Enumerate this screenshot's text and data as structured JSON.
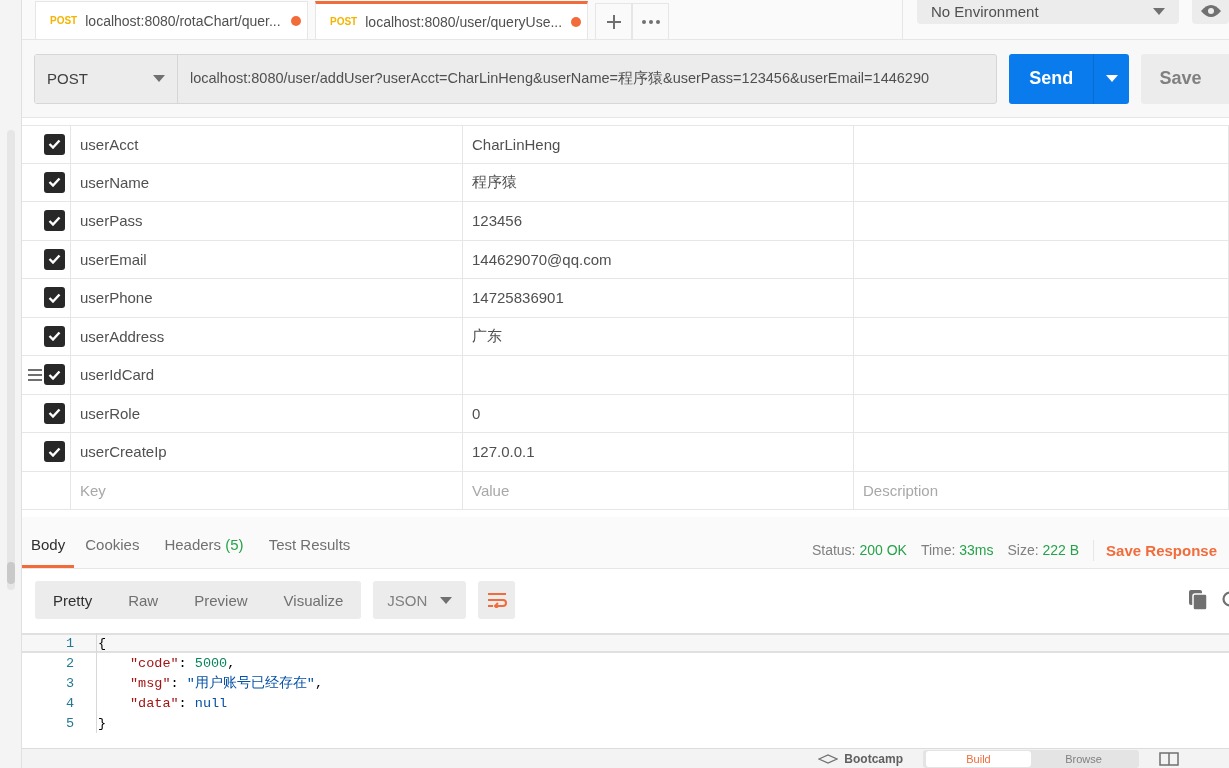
{
  "tabs": [
    {
      "method": "POST",
      "label": "localhost:8080/rotaChart/quer...",
      "selected": false,
      "unsaved": true
    },
    {
      "method": "POST",
      "label": "localhost:8080/user/queryUse...",
      "selected": true,
      "unsaved": true
    }
  ],
  "environment": {
    "label": "No Environment"
  },
  "request": {
    "method": "POST",
    "url": "localhost:8080/user/addUser?userAcct=CharLinHeng&userName=程序猿&userPass=123456&userEmail=1446290",
    "send": "Send",
    "save": "Save"
  },
  "params": {
    "rows": [
      {
        "key": "userAcct",
        "value": "CharLinHeng",
        "checked": true,
        "hovered": false
      },
      {
        "key": "userName",
        "value": "程序猿",
        "checked": true,
        "hovered": false
      },
      {
        "key": "userPass",
        "value": "123456",
        "checked": true,
        "hovered": false
      },
      {
        "key": "userEmail",
        "value": "144629070@qq.com",
        "checked": true,
        "hovered": false
      },
      {
        "key": "userPhone",
        "value": "14725836901",
        "checked": true,
        "hovered": false
      },
      {
        "key": "userAddress",
        "value": "广东",
        "checked": true,
        "hovered": false
      },
      {
        "key": "userIdCard",
        "value": "",
        "checked": true,
        "hovered": true
      },
      {
        "key": "userRole",
        "value": "0",
        "checked": true,
        "hovered": false
      },
      {
        "key": "userCreateIp",
        "value": "127.0.0.1",
        "checked": true,
        "hovered": false
      }
    ],
    "new_row": {
      "key_placeholder": "Key",
      "value_placeholder": "Value",
      "description_placeholder": "Description"
    }
  },
  "response": {
    "tabs": [
      {
        "label": "Body",
        "selected": true
      },
      {
        "label": "Cookies",
        "selected": false
      },
      {
        "label": "Headers",
        "count": "(5)",
        "selected": false
      },
      {
        "label": "Test Results",
        "selected": false
      }
    ],
    "stats": [
      {
        "label": "Status:",
        "value": "200 OK"
      },
      {
        "label": "Time:",
        "value": "33ms"
      },
      {
        "label": "Size:",
        "value": "222 B"
      }
    ],
    "save_response": "Save Response",
    "views": [
      {
        "label": "Pretty",
        "selected": true
      },
      {
        "label": "Raw",
        "selected": false
      },
      {
        "label": "Preview",
        "selected": false
      },
      {
        "label": "Visualize",
        "selected": false
      }
    ],
    "format": "JSON",
    "lines": [
      {
        "number": "1",
        "nested": false,
        "active": true,
        "tokens": [
          {
            "kind": "punct",
            "text": "{"
          }
        ]
      },
      {
        "number": "2",
        "nested": true,
        "active": false,
        "tokens": [
          {
            "kind": "key",
            "text": "\"code\""
          },
          {
            "kind": "punct",
            "text": ": "
          },
          {
            "kind": "number",
            "text": "5000"
          },
          {
            "kind": "punct",
            "text": ","
          }
        ]
      },
      {
        "number": "3",
        "nested": true,
        "active": false,
        "tokens": [
          {
            "kind": "key",
            "text": "\"msg\""
          },
          {
            "kind": "punct",
            "text": ": "
          },
          {
            "kind": "string",
            "text": "\"用户账号已经存在\""
          },
          {
            "kind": "punct",
            "text": ","
          }
        ]
      },
      {
        "number": "4",
        "nested": true,
        "active": false,
        "tokens": [
          {
            "kind": "key",
            "text": "\"data\""
          },
          {
            "kind": "punct",
            "text": ": "
          },
          {
            "kind": "keyword",
            "text": "null"
          }
        ]
      },
      {
        "number": "5",
        "nested": false,
        "active": false,
        "tokens": [
          {
            "kind": "punct",
            "text": "}"
          }
        ]
      }
    ]
  },
  "footer": {
    "bootcamp": "Bootcamp",
    "modes": [
      {
        "label": "Build",
        "selected": true
      },
      {
        "label": "Browse",
        "selected": false
      }
    ]
  }
}
